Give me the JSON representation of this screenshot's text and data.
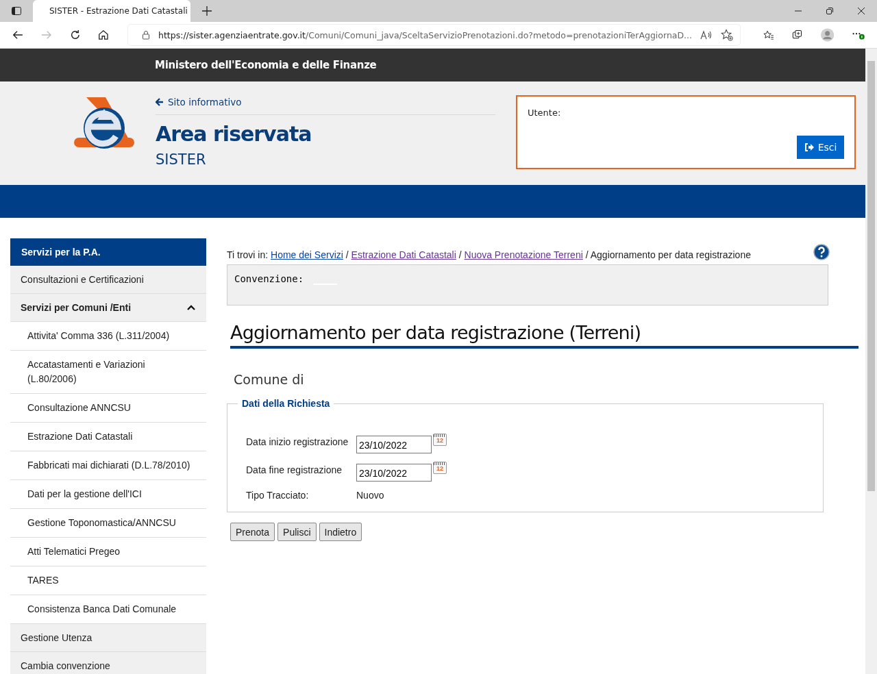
{
  "browser": {
    "tab_title": "SISTER - Estrazione Dati Catastali",
    "url_host": "https://sister.agenziaentrate.gov.it",
    "url_path": "/Comuni/Comuni_java/SceltaServizioPrenotazioni.do?metodo=prenotazioniTerAggiornaD..."
  },
  "top_bar": {
    "title": "Ministero dell'Economia e delle Finanze"
  },
  "header": {
    "back_link": "Sito informativo",
    "title": "Area riservata",
    "subtitle": "SISTER",
    "user_label": "Utente:",
    "logout_button": "Esci"
  },
  "sidebar": {
    "title": "Servizi per la P.A.",
    "items": [
      {
        "label": "Consultazioni e Certificazioni"
      },
      {
        "label": "Servizi per Comuni /Enti",
        "expanded": true,
        "children": [
          {
            "label": "Attivita' Comma 336 (L.311/2004)"
          },
          {
            "label": "Accatastamenti e Variazioni (L.80/2006)"
          },
          {
            "label": "Consultazione ANNCSU"
          },
          {
            "label": "Estrazione Dati Catastali"
          },
          {
            "label": "Fabbricati mai dichiarati (D.L.78/2010)"
          },
          {
            "label": "Dati per la gestione dell'ICI"
          },
          {
            "label": "Gestione Toponomastica/ANNCSU"
          },
          {
            "label": "Atti Telematici Pregeo"
          },
          {
            "label": "TARES"
          },
          {
            "label": "Consistenza Banca Dati Comunale"
          }
        ]
      },
      {
        "label": "Gestione Utenza"
      },
      {
        "label": "Cambia convenzione"
      }
    ]
  },
  "breadcrumb": {
    "prefix": "Ti trovi in:",
    "links": [
      {
        "label": "Home dei Servizi",
        "visited": false
      },
      {
        "label": "Estrazione Dati Catastali",
        "visited": true
      },
      {
        "label": "Nuova Prenotazione Terreni",
        "visited": true
      }
    ],
    "separator": "/",
    "current": "Aggiornamento per data registrazione"
  },
  "convention": {
    "label": "Convenzione:"
  },
  "page_title": "Aggiornamento per data registrazione (Terreni)",
  "comune_label": "Comune di",
  "form": {
    "legend": "Dati della Richiesta",
    "date_fields": [
      {
        "label": "Data inizio registrazione",
        "value": "23/10/2022",
        "calendar_day": "12"
      },
      {
        "label": "Data fine registrazione",
        "value": "23/10/2022",
        "calendar_day": "12"
      }
    ],
    "trace_label": "Tipo Tracciato:",
    "trace_value": "Nuovo"
  },
  "buttons": [
    "Prenota",
    "Pulisci",
    "Indietro"
  ]
}
